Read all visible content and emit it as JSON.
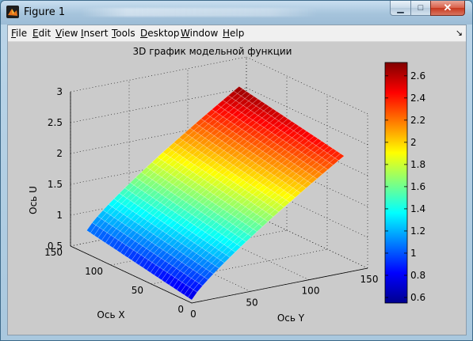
{
  "window": {
    "title": "Figure 1",
    "minimize_glyph": "▁",
    "maximize_glyph": "□",
    "close_glyph": "✕"
  },
  "menu": {
    "items": [
      {
        "label": "File",
        "mnemonic": "F"
      },
      {
        "label": "Edit",
        "mnemonic": "E"
      },
      {
        "label": "View",
        "mnemonic": "V"
      },
      {
        "label": "Insert",
        "mnemonic": "I"
      },
      {
        "label": "Tools",
        "mnemonic": "T"
      },
      {
        "label": "Desktop",
        "mnemonic": "D"
      },
      {
        "label": "Window",
        "mnemonic": "W"
      },
      {
        "label": "Help",
        "mnemonic": "H"
      }
    ],
    "dock_glyph": "↘"
  },
  "chart_data": {
    "type": "surface",
    "title": "3D график модельной функции",
    "xlabel": "Ось  X",
    "ylabel": "Ось  Y",
    "zlabel": "Ось U",
    "xlim": [
      0,
      150
    ],
    "ylim": [
      0,
      150
    ],
    "zlim": [
      0.5,
      3
    ],
    "x_ticks": [
      "0",
      "50",
      "100",
      "150"
    ],
    "y_ticks": [
      "0",
      "50",
      "100",
      "150"
    ],
    "z_ticks": [
      "0.5",
      "1",
      "1.5",
      "2",
      "2.5",
      "3"
    ],
    "colormap": "jet",
    "colorbar": {
      "range": [
        0.55,
        2.72
      ],
      "ticks": [
        "0.6",
        "0.8",
        "1",
        "1.2",
        "1.4",
        "1.6",
        "1.8",
        "2",
        "2.2",
        "2.4",
        "2.6"
      ]
    },
    "surface": {
      "x_range": [
        0,
        130
      ],
      "y_range": [
        0,
        130
      ],
      "u_min": 0.55,
      "u_max": 2.72
    }
  }
}
